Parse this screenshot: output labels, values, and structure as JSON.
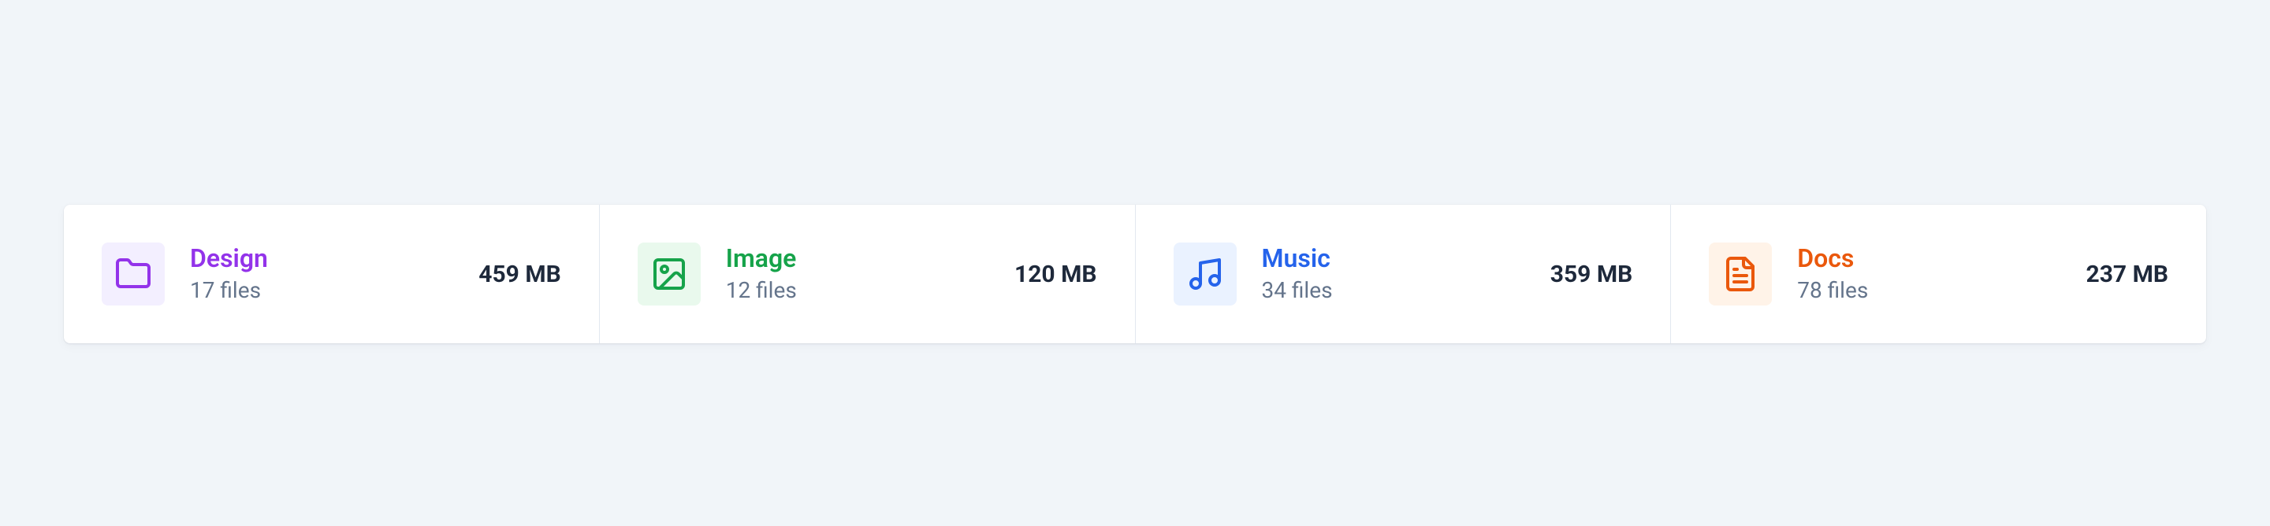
{
  "categories": [
    {
      "key": "design",
      "name": "Design",
      "files": "17 files",
      "size": "459 MB"
    },
    {
      "key": "image",
      "name": "Image",
      "files": "12 files",
      "size": "120 MB"
    },
    {
      "key": "music",
      "name": "Music",
      "files": "34 files",
      "size": "359 MB"
    },
    {
      "key": "docs",
      "name": "Docs",
      "files": "78 files",
      "size": "237 MB"
    }
  ]
}
